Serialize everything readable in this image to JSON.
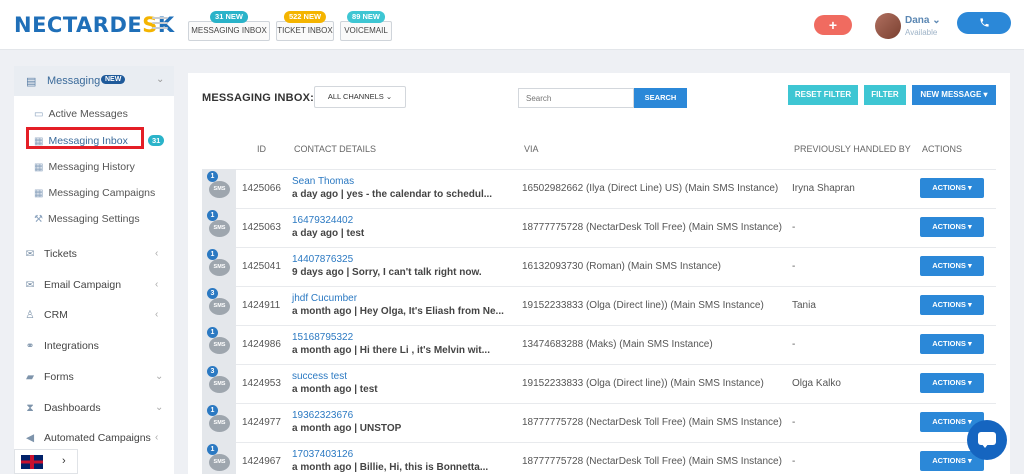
{
  "header": {
    "logo": "NECTARDESK",
    "buttons": [
      {
        "label": "MESSAGING INBOX",
        "badge": "31 NEW",
        "badge_color": "#2ab3c9"
      },
      {
        "label": "TICKET INBOX",
        "badge": "522 NEW",
        "badge_color": "#f4b400"
      },
      {
        "label": "VOICEMAIL",
        "badge": "89 NEW",
        "badge_color": "#3ec6d3"
      }
    ],
    "plus": "+",
    "user_name": "Dana ⌄",
    "user_status": "Available",
    "call_icon": "phone-icon"
  },
  "sidebar": {
    "messaging_label": "Messaging",
    "messaging_badge": "NEW",
    "sub_items": [
      {
        "label": "Active Messages"
      },
      {
        "label": "Messaging Inbox",
        "count": "31"
      },
      {
        "label": "Messaging History"
      },
      {
        "label": "Messaging Campaigns"
      },
      {
        "label": "Messaging Settings"
      }
    ],
    "nav": [
      {
        "label": "Tickets"
      },
      {
        "label": "Email Campaign"
      },
      {
        "label": "CRM"
      },
      {
        "label": "Integrations"
      },
      {
        "label": "Forms"
      },
      {
        "label": "Dashboards"
      },
      {
        "label": "Automated Campaigns"
      }
    ],
    "language": "English (UK)"
  },
  "main": {
    "title": "MESSAGING INBOX:",
    "channels": "ALL CHANNELS ⌄",
    "search_placeholder": "Search",
    "search_button": "SEARCH",
    "reset_filter": "RESET FILTER",
    "filter": "FILTER",
    "new_message": "NEW MESSAGE ▾",
    "columns": {
      "id": "ID",
      "contact": "CONTACT DETAILS",
      "via": "VIA",
      "prev": "PREVIOUSLY HANDLED BY",
      "actions": "ACTIONS"
    },
    "rows": [
      {
        "count": "1",
        "id": "1425066",
        "name": "Sean Thomas",
        "msg": "a day ago | yes - the calendar to schedul...",
        "via": "16502982662 (Ilya (Direct Line) US) (Main SMS Instance)",
        "prev": "Iryna Shapran",
        "action": "ACTIONS ▾"
      },
      {
        "count": "1",
        "id": "1425063",
        "name": "16479324402",
        "msg": "a day ago | test",
        "via": "18777775728 (NectarDesk Toll Free) (Main SMS Instance)",
        "prev": "-",
        "action": "ACTIONS ▾"
      },
      {
        "count": "1",
        "id": "1425041",
        "name": "14407876325",
        "msg": "9 days ago | Sorry, I can't talk right now.",
        "via": "16132093730 (Roman) (Main SMS Instance)",
        "prev": "-",
        "action": "ACTIONS ▾"
      },
      {
        "count": "3",
        "id": "1424911",
        "name": "jhdf Cucumber",
        "msg": "a month ago | Hey Olga, It's Eliash from Ne...",
        "via": "19152233833 (Olga (Direct line)) (Main SMS Instance)",
        "prev": "Tania",
        "action": "ACTIONS ▾"
      },
      {
        "count": "1",
        "id": "1424986",
        "name": "15168795322",
        "msg": "a month ago | Hi there Li , it's Melvin wit...",
        "via": "13474683288 (Maks) (Main SMS Instance)",
        "prev": "-",
        "action": "ACTIONS ▾"
      },
      {
        "count": "3",
        "id": "1424953",
        "name": "success test",
        "msg": "a month ago | test",
        "via": "19152233833 (Olga (Direct line)) (Main SMS Instance)",
        "prev": "Olga Kalko",
        "action": "ACTIONS ▾"
      },
      {
        "count": "1",
        "id": "1424977",
        "name": "19362323676",
        "msg": "a month ago | UNSTOP",
        "via": "18777775728 (NectarDesk Toll Free) (Main SMS Instance)",
        "prev": "-",
        "action": "ACTIONS ▾"
      },
      {
        "count": "1",
        "id": "1424967",
        "name": "17037403126",
        "msg": "a month ago | Billie, Hi, this is Bonnetta...",
        "via": "18777775728 (NectarDesk Toll Free) (Main SMS Instance)",
        "prev": "-",
        "action": "ACTIONS ▾"
      }
    ]
  }
}
